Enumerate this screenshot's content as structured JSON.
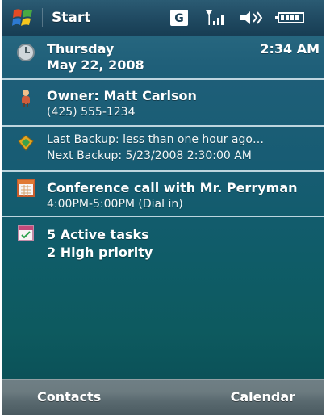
{
  "titlebar": {
    "start_label": "Start",
    "icons": [
      "windows-logo",
      "gprs-icon",
      "signal-icon",
      "volume-icon",
      "battery-icon"
    ]
  },
  "today": {
    "date": {
      "day": "Thursday",
      "full_date": "May 22, 2008",
      "time": "2:34 AM"
    },
    "owner": {
      "label": "Owner: Matt Carlson",
      "phone": "(425) 555-1234"
    },
    "backup": {
      "last": "Last Backup:  less than one hour ago…",
      "next": "Next Backup: 5/23/2008 2:30:00 AM"
    },
    "appointment": {
      "title": "Conference call with Mr. Perryman",
      "details": "4:00PM-5:00PM (Dial in)"
    },
    "tasks": {
      "active": "5 Active tasks",
      "high": "2 High priority"
    }
  },
  "softkeys": {
    "left": "Contacts",
    "right": "Calendar"
  },
  "colors": {
    "divider": "#cfe2ea",
    "title_bar": "#204a62",
    "background_top": "#2f6f86",
    "background_bottom": "#0b4b53"
  }
}
